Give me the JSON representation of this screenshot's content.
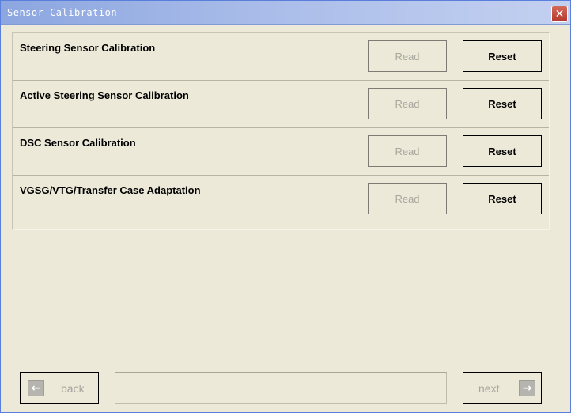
{
  "window": {
    "title": "Sensor Calibration",
    "close_glyph": "✕",
    "accent_color": "#a9bce9"
  },
  "rows": [
    {
      "label": "Steering Sensor Calibration",
      "read_label": "Read",
      "reset_label": "Reset",
      "read_enabled": false
    },
    {
      "label": "Active Steering Sensor Calibration",
      "read_label": "Read",
      "reset_label": "Reset",
      "read_enabled": false
    },
    {
      "label": "DSC Sensor Calibration",
      "read_label": "Read",
      "reset_label": "Reset",
      "read_enabled": false
    },
    {
      "label": "VGSG/VTG/Transfer Case Adaptation",
      "read_label": "Read",
      "reset_label": "Reset",
      "read_enabled": false
    }
  ],
  "footer": {
    "back_label": "back",
    "back_icon": "arrow-left-icon",
    "back_glyph": "←",
    "next_label": "next",
    "next_icon": "arrow-right-icon",
    "next_glyph": "→",
    "status_text": ""
  }
}
